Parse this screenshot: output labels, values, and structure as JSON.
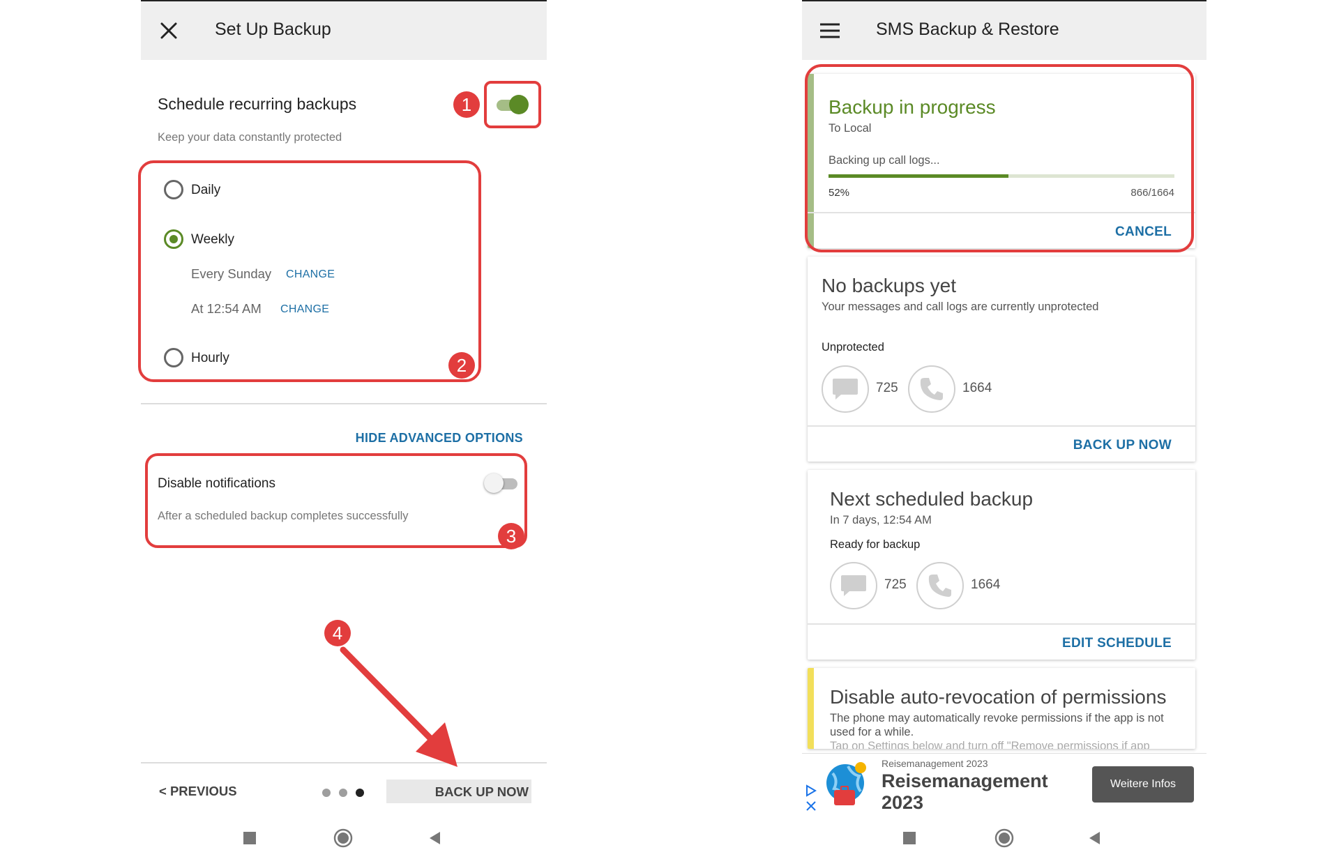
{
  "left": {
    "title": "Set Up Backup",
    "schedule": {
      "title": "Schedule recurring backups",
      "subtitle": "Keep your data constantly protected",
      "enabled": true
    },
    "frequency": {
      "options": [
        {
          "label": "Daily",
          "selected": false
        },
        {
          "label": "Weekly",
          "selected": true
        },
        {
          "label": "Hourly",
          "selected": false
        }
      ],
      "day_text": "Every Sunday",
      "day_change": "CHANGE",
      "time_text": "At 12:54 AM",
      "time_change": "CHANGE"
    },
    "advanced_link": "HIDE ADVANCED OPTIONS",
    "notifications": {
      "title": "Disable notifications",
      "subtitle": "After a scheduled backup completes successfully",
      "enabled": false
    },
    "footer": {
      "previous": "< PREVIOUS",
      "backup_now": "BACK UP NOW",
      "pages": 3,
      "current_page": 3
    }
  },
  "right": {
    "title": "SMS Backup & Restore",
    "progress_card": {
      "title": "Backup in progress",
      "destination": "To Local",
      "status": "Backing up call logs...",
      "percent_text": "52%",
      "percent": 52,
      "count_text": "866/1664",
      "action": "CANCEL"
    },
    "no_backups_card": {
      "title": "No backups yet",
      "subtitle": "Your messages and call logs are currently unprotected",
      "state": "Unprotected",
      "messages": "725",
      "calls": "1664",
      "action": "BACK UP NOW"
    },
    "next_card": {
      "title": "Next scheduled backup",
      "subtitle": "In 7 days, 12:54 AM",
      "state": "Ready for backup",
      "messages": "725",
      "calls": "1664",
      "action": "EDIT SCHEDULE"
    },
    "revoke_card": {
      "title": "Disable auto-revocation of permissions",
      "line1": "The phone may automatically revoke permissions if the app is not",
      "line2": "used for a while.",
      "line3": "Tap on Settings below and turn off \"Remove permissions if app"
    },
    "ad": {
      "small": "Reisemanagement 2023",
      "big1": "Reisemanagement",
      "big2": "2023",
      "button": "Weitere Infos"
    }
  },
  "annotations": [
    "1",
    "2",
    "3",
    "4"
  ],
  "colors": {
    "accent_green": "#5b8a26",
    "link_blue": "#1d6fa5",
    "highlight_red": "#e23d3d",
    "warning_yellow": "#f2df5a"
  }
}
